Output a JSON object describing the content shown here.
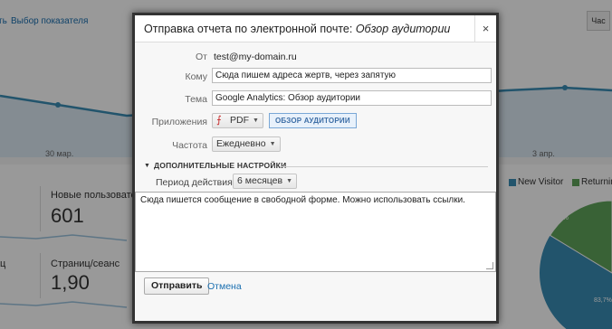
{
  "background": {
    "links": [
      "ть",
      "Выбор показателя"
    ],
    "range_buttons": [
      "Час"
    ],
    "axis_labels": [
      "30 мар.",
      "3 апр."
    ],
    "metrics": [
      {
        "label": "Новые пользовател",
        "value": "601"
      },
      {
        "label": "ц",
        "value": ""
      },
      {
        "label": "Страниц/сеанс",
        "value": "1,90"
      }
    ],
    "legend": [
      {
        "label": "New Visitor",
        "color": "#3a8db5"
      },
      {
        "label": "Returnin",
        "color": "#5fa35b"
      }
    ],
    "pie": {
      "slices": [
        {
          "label": "16,3%",
          "value": 16.3,
          "color": "#5fa35b"
        },
        {
          "label": "83,7%",
          "value": 83.7,
          "color": "#3a8db5"
        }
      ]
    }
  },
  "dialog": {
    "title_prefix": "Отправка отчета по электронной почте: ",
    "title_report": "Обзор аудитории",
    "close_label": "×",
    "from": {
      "label": "От",
      "value": "test@my-domain.ru"
    },
    "to": {
      "label": "Кому",
      "value": "Сюда пишем адреса жертв, через запятую"
    },
    "subject": {
      "label": "Тема",
      "value": "Google Analytics: Обзор аудитории"
    },
    "attachments": {
      "label": "Приложения",
      "format": "PDF",
      "report": "ОБЗОР АУДИТОРИИ"
    },
    "frequency": {
      "label": "Частота",
      "value": "Ежедневно"
    },
    "advanced": {
      "title": "ДОПОЛНИТЕЛЬНЫЕ НАСТРОЙКИ"
    },
    "period": {
      "label": "Период действия:",
      "value": "6 месяцев"
    },
    "message": "Сюда пишется сообщение в свободной форме. Можно использовать ссылки.",
    "send_label": "Отправить",
    "cancel_label": "Отмена"
  }
}
